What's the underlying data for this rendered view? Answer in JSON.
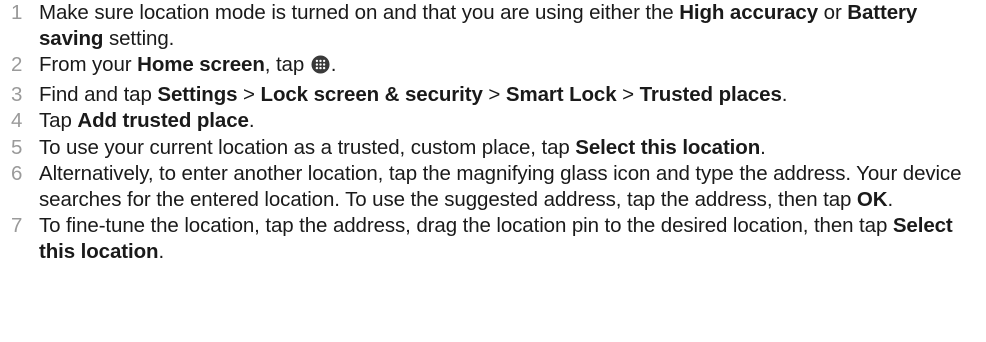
{
  "steps": [
    {
      "number": "1",
      "parts": [
        {
          "t": "Make sure location mode is turned on and that you are using either the "
        },
        {
          "t": "High accuracy",
          "b": true
        },
        {
          "t": " or "
        },
        {
          "t": "Battery saving",
          "b": true
        },
        {
          "t": " setting."
        }
      ]
    },
    {
      "number": "2",
      "parts": [
        {
          "t": "From your "
        },
        {
          "t": "Home screen",
          "b": true
        },
        {
          "t": ", tap "
        },
        {
          "icon": "apps-icon"
        },
        {
          "t": "."
        }
      ]
    },
    {
      "number": "3",
      "parts": [
        {
          "t": "Find and tap "
        },
        {
          "t": "Settings",
          "b": true
        },
        {
          "t": " > "
        },
        {
          "t": "Lock screen & security",
          "b": true
        },
        {
          "t": " > "
        },
        {
          "t": "Smart Lock",
          "b": true
        },
        {
          "t": " > "
        },
        {
          "t": "Trusted places",
          "b": true
        },
        {
          "t": "."
        }
      ]
    },
    {
      "number": "4",
      "parts": [
        {
          "t": "Tap "
        },
        {
          "t": "Add trusted place",
          "b": true
        },
        {
          "t": "."
        }
      ]
    },
    {
      "number": "5",
      "parts": [
        {
          "t": "To use your current location as a trusted, custom place, tap "
        },
        {
          "t": "Select this location",
          "b": true
        },
        {
          "t": "."
        }
      ]
    },
    {
      "number": "6",
      "parts": [
        {
          "t": "Alternatively, to enter another location, tap the magnifying glass icon and type the address. Your device searches for the entered location. To use the suggested address, tap the address, then tap "
        },
        {
          "t": "OK",
          "b": true
        },
        {
          "t": "."
        }
      ]
    },
    {
      "number": "7",
      "parts": [
        {
          "t": "To fine-tune the location, tap the address, drag the location pin to the desired location, then tap "
        },
        {
          "t": "Select this location",
          "b": true
        },
        {
          "t": "."
        }
      ]
    }
  ],
  "colors": {
    "text": "#1a1a1a",
    "step_number": "#9a9a9a",
    "icon_fill": "#3a3a3a",
    "icon_dots": "#ffffff"
  }
}
